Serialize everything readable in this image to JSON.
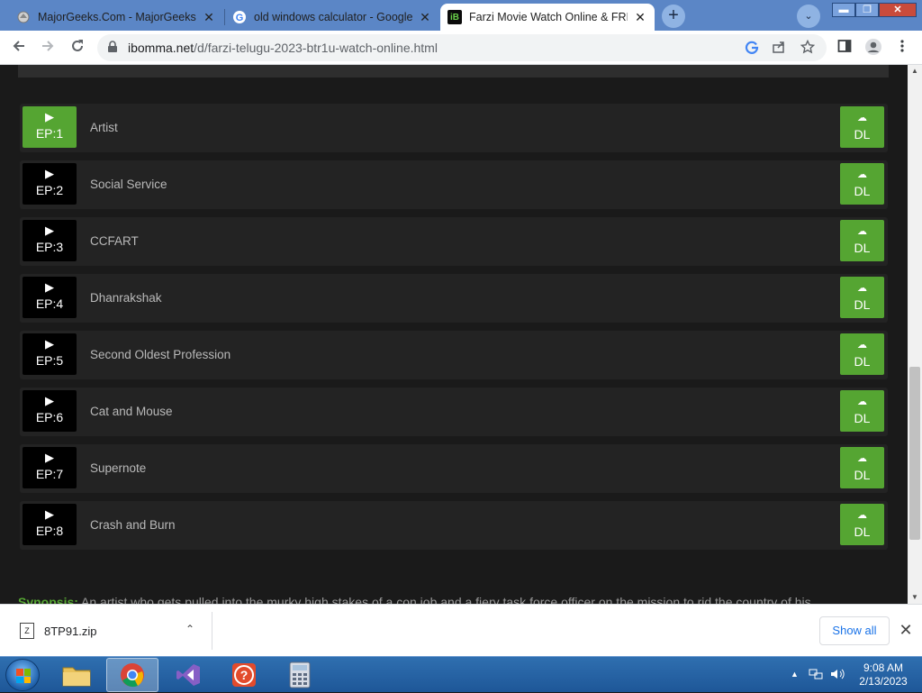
{
  "browser": {
    "tabs": [
      {
        "title": "MajorGeeks.Com - MajorGeeks",
        "favicon": "majorgeeks-favicon-icon",
        "active": false
      },
      {
        "title": "old windows calculator - Google",
        "favicon": "google-favicon-icon",
        "active": false
      },
      {
        "title": "Farzi Movie Watch Online & FREE",
        "favicon": "ibomma-favicon-icon",
        "active": true
      }
    ],
    "favicon_text": {
      "ibomma": "iB",
      "google": "G"
    },
    "close_glyph": "✕",
    "new_tab_glyph": "+",
    "tab_list_glyph": "⌄",
    "url_host": "ibomma.net",
    "url_path": "/d/farzi-telugu-2023-btr1u-watch-online.html",
    "window_controls": {
      "minimize": "▬",
      "maximize": "❐",
      "close": "✕"
    }
  },
  "episodes": [
    {
      "ep": "EP:1",
      "title": "Artist"
    },
    {
      "ep": "EP:2",
      "title": "Social Service"
    },
    {
      "ep": "EP:3",
      "title": "CCFART"
    },
    {
      "ep": "EP:4",
      "title": "Dhanrakshak"
    },
    {
      "ep": "EP:5",
      "title": "Second Oldest Profession"
    },
    {
      "ep": "EP:6",
      "title": "Cat and Mouse"
    },
    {
      "ep": "EP:7",
      "title": "Supernote"
    },
    {
      "ep": "EP:8",
      "title": "Crash and Burn"
    }
  ],
  "episode_ui": {
    "play_glyph": "▶",
    "download_label": "DL",
    "cloud_glyph": "☁"
  },
  "synopsis": {
    "label": "Synopsis:",
    "text": " An artist who gets pulled into the murky high stakes of a con job and a fiery task force officer on the mission to rid the country of his"
  },
  "downloads": {
    "file_name": "8TP91.zip",
    "chevron": "⌃",
    "show_all": "Show all",
    "close_glyph": "✕"
  },
  "taskbar": {
    "apps": [
      "file-explorer",
      "chrome",
      "visual-studio",
      "help",
      "calculator"
    ],
    "time": "9:08 AM",
    "date": "2/13/2023"
  },
  "colors": {
    "accent_green": "#55a532",
    "page_bg": "#1a1a1a",
    "row_bg": "#232323",
    "tabstrip": "#5b86c6"
  }
}
